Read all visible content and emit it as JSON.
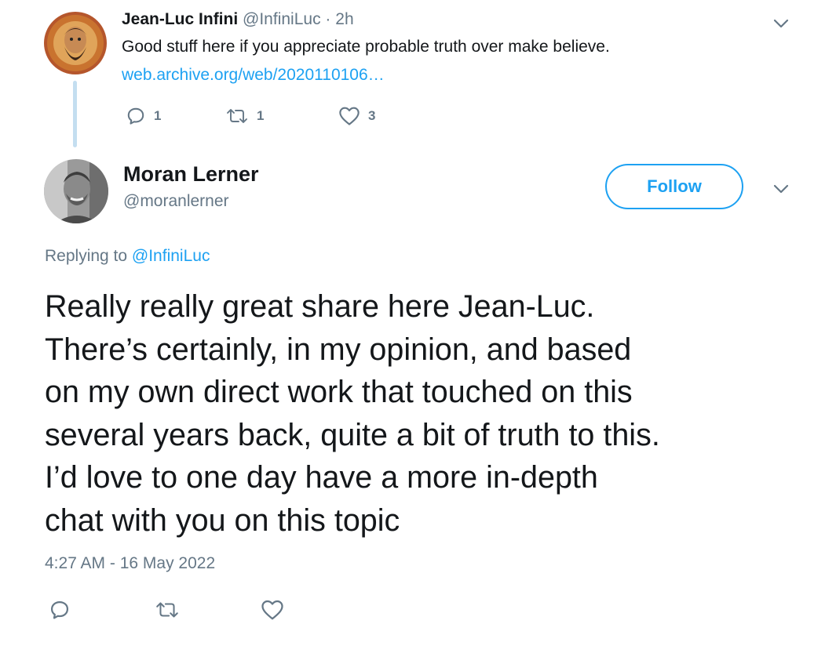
{
  "parent_tweet": {
    "name": "Jean-Luc Infini",
    "handle": "@InfiniLuc",
    "separator": "·",
    "time": "2h",
    "text": "Good stuff here if you appreciate probable truth over make believe.",
    "link": "web.archive.org/web/2020110106…",
    "reply_count": "1",
    "retweet_count": "1",
    "like_count": "3",
    "icons": [
      "reply-icon",
      "retweet-icon",
      "like-icon",
      "chevron-down-icon"
    ]
  },
  "main_tweet": {
    "name": "Moran Lerner",
    "handle": "@moranlerner",
    "follow_label": "Follow",
    "replying_prefix": "Replying to",
    "replying_to": "@InfiniLuc",
    "body_lines": [
      "Really really great share here Jean-Luc.",
      "There’s certainly, in my opinion, and based",
      "on my own direct work that touched on this",
      "several years back, quite a bit of truth to this.",
      "I’d love to one day have a more in-depth",
      "chat with you on this topic"
    ],
    "timestamp": "4:27 AM - 16 May 2022",
    "icons": [
      "reply-icon",
      "retweet-icon",
      "like-icon",
      "chevron-down-icon"
    ]
  },
  "colors": {
    "accent": "#1da1f2",
    "text": "#14171a",
    "secondary": "#657786",
    "thread_line": "#c4def0"
  }
}
